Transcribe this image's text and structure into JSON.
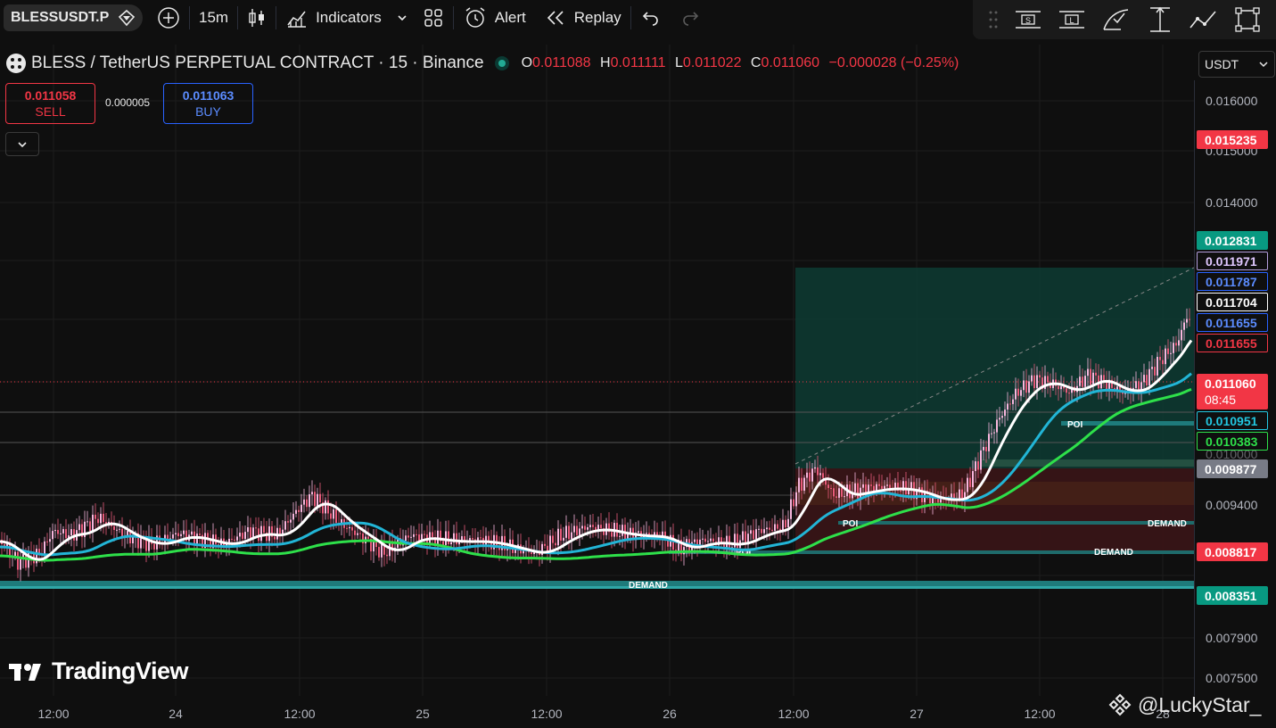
{
  "toolbar": {
    "symbol": "BLESSUSDT.P",
    "interval": "15m",
    "indicators_label": "Indicators",
    "alert_label": "Alert",
    "replay_label": "Replay"
  },
  "legend": {
    "title": "BLESS / TetherUS PERPETUAL CONTRACT · 15 · Binance",
    "o_label": "O",
    "o_value": "0.011088",
    "h_label": "H",
    "h_value": "0.011111",
    "l_label": "L",
    "l_value": "0.011022",
    "c_label": "C",
    "c_value": "0.011060",
    "change": "−0.000028 (−0.25%)"
  },
  "trade": {
    "sell_price": "0.011058",
    "sell_label": "SELL",
    "spread": "0.000005",
    "buy_price": "0.011063",
    "buy_label": "BUY"
  },
  "price_scale": {
    "currency": "USDT",
    "ticks": [
      "0.016000",
      "0.015000",
      "0.014000",
      "0.009400",
      "0.007900",
      "0.007500"
    ],
    "hidden_tick": "0.010000",
    "tags": [
      {
        "value": "0.015235",
        "bg": "#f23645",
        "fg": "#ffffff"
      },
      {
        "value": "0.012831",
        "bg": "#089981",
        "fg": "#ffffff"
      },
      {
        "value": "0.011971",
        "bg": "#0f0f0f",
        "fg": "#e0c8ff",
        "border": "#b39ddb"
      },
      {
        "value": "0.011787",
        "bg": "#0f0f0f",
        "fg": "#5b8cff",
        "border": "#2962ff"
      },
      {
        "value": "0.011704",
        "bg": "#0f0f0f",
        "fg": "#ffffff",
        "border": "#ffffff"
      },
      {
        "value": "0.011655",
        "bg": "#0f0f0f",
        "fg": "#5b8cff",
        "border": "#2962ff"
      },
      {
        "value": "0.011655",
        "bg": "#0f0f0f",
        "fg": "#f23645",
        "border": "#f23645"
      },
      {
        "value": "0.010951",
        "bg": "#0f0f0f",
        "fg": "#22c7e0",
        "border": "#22c7e0"
      },
      {
        "value": "0.010383",
        "bg": "#0f0f0f",
        "fg": "#2ee04a",
        "border": "#2ee04a"
      },
      {
        "value": "0.009877",
        "bg": "#787b86",
        "fg": "#ffffff"
      },
      {
        "value": "0.008817",
        "bg": "#f23645",
        "fg": "#ffffff"
      },
      {
        "value": "0.008351",
        "bg": "#089981",
        "fg": "#ffffff"
      }
    ],
    "last_price": "0.011060",
    "countdown": "08:45"
  },
  "time_axis": [
    "12:00",
    "24",
    "12:00",
    "25",
    "12:00",
    "26",
    "12:00",
    "27",
    "12:00",
    "28"
  ],
  "zones": {
    "demand": "DEMAND",
    "poi": "POI"
  },
  "branding": {
    "logo_text": "TradingView",
    "watermark": "@LuckyStar_"
  },
  "colors": {
    "ema_white": "#ffffff",
    "ema_cyan": "#22b5d6",
    "ema_green": "#2ee04a",
    "candles_pink": "#e8a0c8",
    "bull": "#089981",
    "bear": "#f23645"
  },
  "icons": [
    "diamond-icon",
    "plus-circle-icon",
    "candles-icon",
    "indicators-icon",
    "chevron-down-icon",
    "templates-icon",
    "alert-icon",
    "replay-icon",
    "undo-icon",
    "redo-icon",
    "drag-handle-icon",
    "long-position-icon",
    "short-position-icon",
    "fib-icon",
    "measure-icon",
    "trend-icon",
    "fullscreen-icon"
  ]
}
